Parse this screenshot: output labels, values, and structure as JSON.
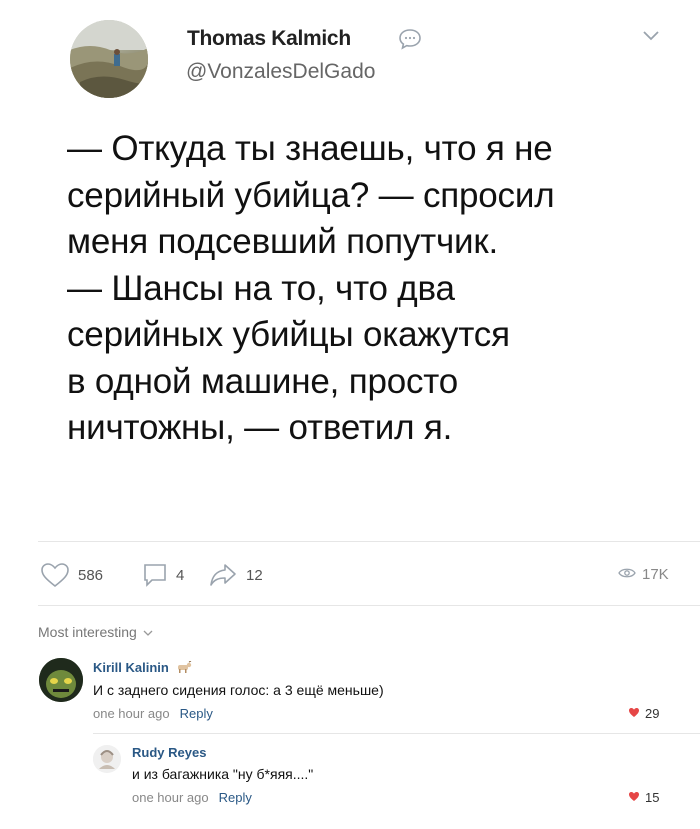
{
  "post": {
    "author_name": "Thomas Kalmich",
    "author_handle": "@VonzalesDelGado",
    "text": "— Откуда ты знаешь, что я не\nсерийный убийца? — спросил\nменя подсевший попутчик.\n— Шансы на то, что два\nсерийных убийцы окажутся\nв одной машине, просто\nничтожны, — ответил я."
  },
  "stats": {
    "likes": "586",
    "comments": "4",
    "shares": "12",
    "views": "17K"
  },
  "comments_sort_label": "Most interesting",
  "comments": [
    {
      "author": "Kirill Kalinin",
      "text": "И с заднего сидения голос: а 3 ещё меньше)",
      "time": "one hour ago",
      "reply_label": "Reply",
      "likes": "29"
    },
    {
      "author": "Rudy Reyes",
      "text": "и из багажника \"ну б*яяя....\"",
      "time": "one hour ago",
      "reply_label": "Reply",
      "likes": "15"
    }
  ],
  "colors": {
    "link": "#2a5885",
    "like_heart": "#e64646",
    "muted": "#888888"
  },
  "icons": [
    "chat-bubble-icon",
    "chevron-down-icon",
    "heart-outline-icon",
    "comment-icon",
    "share-arrow-icon",
    "eye-icon",
    "heart-icon"
  ]
}
